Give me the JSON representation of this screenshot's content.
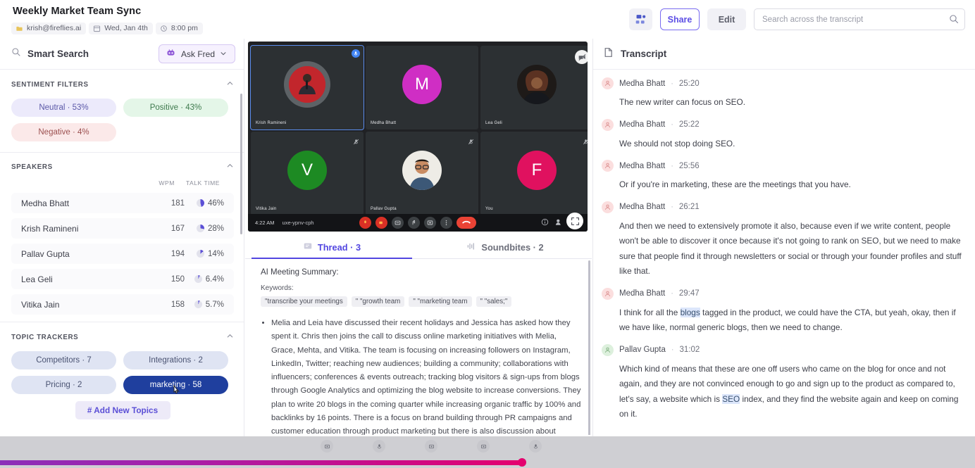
{
  "header": {
    "title": "Weekly Market Team Sync",
    "meta": [
      {
        "icon": "owner-icon",
        "text": "krish@fireflies.ai"
      },
      {
        "icon": "calendar-icon",
        "text": "Wed, Jan 4th"
      },
      {
        "icon": "clock-icon",
        "text": "8:00 pm"
      }
    ],
    "share_label": "Share",
    "edit_label": "Edit",
    "search_placeholder": "Search across the transcript",
    "search_value": ""
  },
  "sidebar": {
    "smart_search_label": "Smart Search",
    "ask_fred_label": "Ask Fred",
    "sentiment": {
      "title": "SENTIMENT FILTERS",
      "chips": [
        {
          "label": "Neutral · 53%",
          "kind": "neutral"
        },
        {
          "label": "Positive · 43%",
          "kind": "positive"
        },
        {
          "label": "Negative · 4%",
          "kind": "negative"
        }
      ]
    },
    "speakers": {
      "title": "SPEAKERS",
      "col_wpm": "WPM",
      "col_talk": "TALK TIME",
      "rows": [
        {
          "name": "Medha Bhatt",
          "wpm": "181",
          "talk": "46%",
          "color": "#5b4fd6",
          "pct": 46
        },
        {
          "name": "Krish Ramineni",
          "wpm": "167",
          "talk": "28%",
          "color": "#5b4fd6",
          "pct": 28
        },
        {
          "name": "Pallav Gupta",
          "wpm": "194",
          "talk": "14%",
          "color": "#5b4fd6",
          "pct": 14
        },
        {
          "name": "Lea Geli",
          "wpm": "150",
          "talk": "6.4%",
          "color": "#5b4fd6",
          "pct": 6.4
        },
        {
          "name": "Vitika Jain",
          "wpm": "158",
          "talk": "5.7%",
          "color": "#5b4fd6",
          "pct": 5.7
        }
      ]
    },
    "topics": {
      "title": "TOPIC TRACKERS",
      "chips": [
        {
          "label": "Competitors · 7",
          "active": false
        },
        {
          "label": "Integrations · 2",
          "active": false
        },
        {
          "label": "Pricing · 2",
          "active": false
        },
        {
          "label": "marketing · 58",
          "active": true
        }
      ],
      "add_label": "# Add New Topics"
    }
  },
  "video": {
    "tiles": [
      {
        "name": "Krish Ramineni",
        "type": "photo-red",
        "selected": true,
        "badge": "mic-active"
      },
      {
        "name": "Medha Bhatt",
        "type": "initial",
        "initial": "M",
        "color": "#cf2ec4",
        "badge": "none"
      },
      {
        "name": "Lea Geli",
        "type": "photo-dark",
        "badge": "camera-off"
      },
      {
        "name": "Vitika Jain",
        "type": "initial",
        "initial": "V",
        "color": "#1d8a23",
        "badge": "mic-muted"
      },
      {
        "name": "Pallav Gupta",
        "type": "photo-person",
        "badge": "mic-muted"
      },
      {
        "name": "You",
        "type": "initial",
        "initial": "F",
        "color": "#e0115f",
        "badge": "mic-muted"
      }
    ],
    "bar_time": "4:22 AM",
    "bar_code": "uxe-ypnv-cph"
  },
  "tabs": [
    {
      "label": "Thread · 3",
      "icon": "thread-icon",
      "active": true
    },
    {
      "label": "Soundbites · 2",
      "icon": "soundbite-icon",
      "active": false
    }
  ],
  "summary": {
    "heading": "AI Meeting Summary:",
    "keywords_label": "Keywords:",
    "keywords": [
      "\"transcribe your meetings",
      "\" \"growth team",
      "\" \"marketing team",
      "\" \"sales;\""
    ],
    "bullets": [
      "Melia and Leia have discussed their recent holidays and Jessica has asked how they spent it. Chris then joins the call to discuss online marketing initiatives with Melia, Grace, Mehta, and Vitika. The team is focusing on increasing followers on Instagram, LinkedIn, Twitter; reaching new audiences; building a community; collaborations with influencers; conferences & events outreach; tracking blog visitors & sign-ups from blogs through Google Analytics and optimizing the blog website to increase conversions. They plan to write 20 blogs in the coming quarter while increasing organic traffic by 100% and backlinks by 16 points. There is a focus on brand building through PR campaigns and customer education through product marketing but there is also discussion about creating original content that"
    ]
  },
  "transcript": {
    "title": "Transcript",
    "messages": [
      {
        "speaker": "Medha Bhatt",
        "time": "25:20",
        "avatar": "pink",
        "parts": [
          {
            "t": "The new writer can focus on SEO.",
            "hl": false
          }
        ]
      },
      {
        "speaker": "Medha Bhatt",
        "time": "25:22",
        "avatar": "pink",
        "parts": [
          {
            "t": "We should not stop doing SEO.",
            "hl": false
          }
        ]
      },
      {
        "speaker": "Medha Bhatt",
        "time": "25:56",
        "avatar": "pink",
        "parts": [
          {
            "t": "Or if you're in marketing, these are the meetings that you have.",
            "hl": false
          }
        ]
      },
      {
        "speaker": "Medha Bhatt",
        "time": "26:21",
        "avatar": "pink",
        "parts": [
          {
            "t": "And then we need to extensively promote it also, because even if we write content, people won't be able to discover it once because it's not going to rank on SEO, but we need to make sure that people find it through newsletters or social or through your founder profiles and stuff like that.",
            "hl": false
          }
        ]
      },
      {
        "speaker": "Medha Bhatt",
        "time": "29:47",
        "avatar": "pink",
        "parts": [
          {
            "t": "I think for all the ",
            "hl": false
          },
          {
            "t": "blogs",
            "hl": true
          },
          {
            "t": " tagged in the product, we could have the CTA, but yeah, okay, then if we have like, normal generic blogs, then we need to change.",
            "hl": false
          }
        ]
      },
      {
        "speaker": "Pallav Gupta",
        "time": "31:02",
        "avatar": "green",
        "parts": [
          {
            "t": "Which kind of means that these are one off users who came on the blog for once and not again, and they are not convinced enough to go and sign up to the product as compared to, let's say, a website which is ",
            "hl": false
          },
          {
            "t": "SEO",
            "hl": true
          },
          {
            "t": " index, and they find the website again and keep on coming on it.",
            "hl": false
          }
        ]
      }
    ]
  },
  "player": {
    "progress_percent": 54,
    "accent_start": "#8b2fb8",
    "accent_end": "#e4006e",
    "controls": [
      "screen-icon",
      "mic-icon",
      "screen2-icon",
      "screen3-icon",
      "mic2-icon"
    ]
  }
}
